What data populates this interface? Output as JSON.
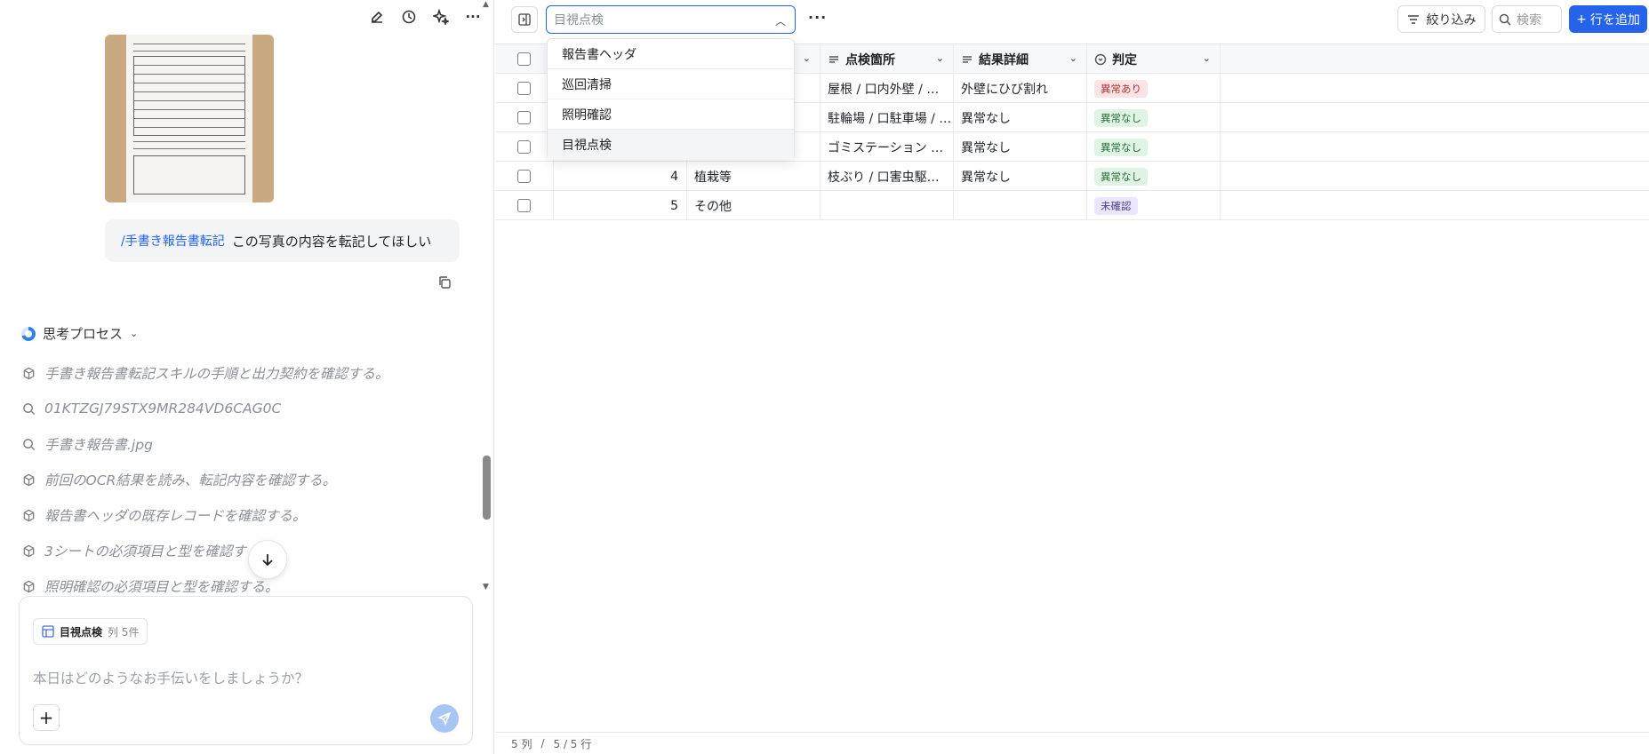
{
  "chat": {
    "user_message": {
      "command": "/手書き報告書転記",
      "text": "この写真の内容を転記してほしい"
    },
    "thinking_label": "思考プロセス",
    "steps": [
      {
        "icon": "cube-icon",
        "text": "手書き報告書転記スキルの手順と出力契約を確認する。"
      },
      {
        "icon": "search-icon",
        "text": "01KTZGJ79STX9MR284VD6CAG0C"
      },
      {
        "icon": "search-icon",
        "text": "手書き報告書.jpg"
      },
      {
        "icon": "cube-icon",
        "text": "前回のOCR結果を読み、転記内容を確認する。"
      },
      {
        "icon": "cube-icon",
        "text": "報告書ヘッダの既存レコードを確認する。"
      },
      {
        "icon": "cube-icon",
        "text": "3シートの必須項目と型を確認す"
      },
      {
        "icon": "cube-icon",
        "text": "照明確認の必須項目と型を確認する。"
      }
    ],
    "composer": {
      "chip_title": "目視点検",
      "chip_sub": "列 5件",
      "placeholder": "本日はどのようなお手伝いをしましょうか？"
    }
  },
  "table": {
    "sheet_select": {
      "value": "目視点検"
    },
    "dropdown_options": [
      "報告書ヘッダ",
      "巡回清掃",
      "照明確認",
      "目視点検"
    ],
    "toolbar": {
      "filter_label": "絞り込み",
      "search_placeholder": "検索",
      "add_row_label": "行を追加"
    },
    "columns": [
      {
        "label": "点検箇所"
      },
      {
        "label": "結果詳細"
      },
      {
        "label": "判定"
      }
    ],
    "rows": [
      {
        "no": "",
        "category": "",
        "location": "屋根 / 口内外壁 / …",
        "detail": "外壁にひび割れ",
        "status": "異常あり",
        "status_color": "red"
      },
      {
        "no": "",
        "category": "",
        "location": "駐輪場 / 口駐車場 / …",
        "detail": "異常なし",
        "status": "異常なし",
        "status_color": "green"
      },
      {
        "no": "",
        "category": "",
        "location": "ゴミステーション …",
        "detail": "異常なし",
        "status": "異常なし",
        "status_color": "green"
      },
      {
        "no": "4",
        "category": "植栽等",
        "location": "枝ぶり / 口害虫駆…",
        "detail": "異常なし",
        "status": "異常なし",
        "status_color": "green"
      },
      {
        "no": "5",
        "category": "その他",
        "location": "",
        "detail": "",
        "status": "未確認",
        "status_color": "purple"
      }
    ],
    "footer": {
      "cols": "5 列",
      "sep": "/",
      "rows": "5 / 5 行"
    }
  },
  "colors": {
    "accent": "#2563eb",
    "abnormal": "#fde4e4",
    "normal": "#dff4e4",
    "unconfirmed": "#ebe6fb"
  }
}
